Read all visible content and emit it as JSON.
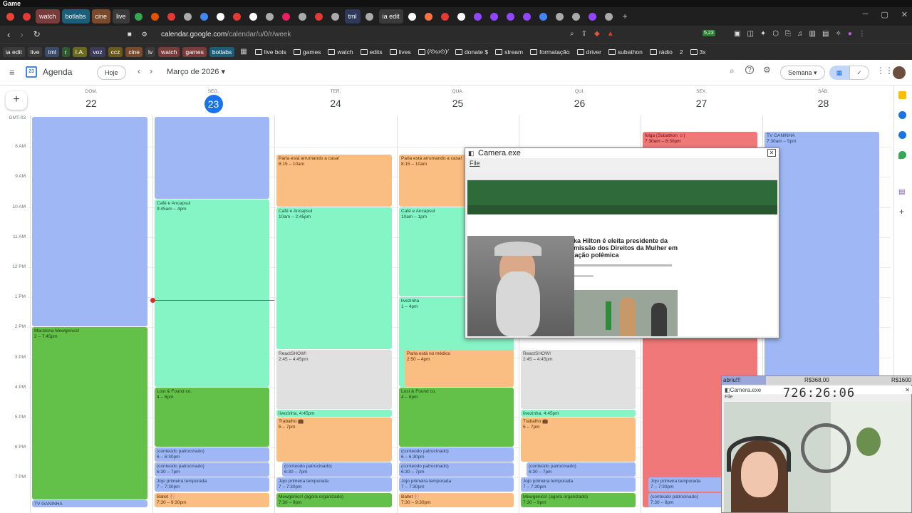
{
  "window": {
    "title": "Game"
  },
  "tabs": [
    {
      "label": "",
      "icon": "chrome-icon",
      "color": "#ea4335"
    },
    {
      "label": "",
      "icon": "record-icon",
      "color": "#e53935"
    },
    {
      "label": "watch",
      "color": "#7a3b3b"
    },
    {
      "label": "botlabs",
      "color": "#1b5e7a"
    },
    {
      "label": "cine",
      "color": "#7a4a2a"
    },
    {
      "label": "live",
      "color": "#3a3a3a"
    },
    {
      "label": "",
      "icon": "google-icon",
      "color": "#34a853"
    },
    {
      "label": "",
      "icon": "app-icon",
      "color": "#e65100"
    },
    {
      "label": "",
      "icon": "app-icon",
      "color": "#e53935"
    },
    {
      "label": "",
      "icon": "app-icon",
      "color": "#aaaaaa"
    },
    {
      "label": "",
      "icon": "app-icon",
      "color": "#4285f4"
    },
    {
      "label": "",
      "icon": "app-icon",
      "color": "#ffffff"
    },
    {
      "label": "",
      "icon": "app-icon",
      "color": "#e53935"
    },
    {
      "label": "",
      "icon": "app-icon",
      "color": "#ffffff"
    },
    {
      "label": "",
      "icon": "app-icon",
      "color": "#aaaaaa"
    },
    {
      "label": "",
      "icon": "app-icon",
      "color": "#e91e63"
    },
    {
      "label": "",
      "icon": "app-icon",
      "color": "#aaaaaa"
    },
    {
      "label": "",
      "icon": "app-icon",
      "color": "#e53935"
    },
    {
      "label": "",
      "icon": "app-icon",
      "color": "#aaaaaa"
    },
    {
      "label": "tml",
      "color": "#2f3a5a"
    },
    {
      "label": "",
      "icon": "app-icon",
      "color": "#aaaaaa"
    },
    {
      "label": "ia edit",
      "color": "#3a3a3a"
    },
    {
      "label": "",
      "icon": "tiktok-icon",
      "color": "#ffffff"
    },
    {
      "label": "",
      "icon": "app-icon",
      "color": "#ff7043"
    },
    {
      "label": "",
      "icon": "app-icon",
      "color": "#e53935"
    },
    {
      "label": "",
      "icon": "app-icon",
      "color": "#ffffff"
    },
    {
      "label": "",
      "icon": "twitch-icon",
      "color": "#9146ff"
    },
    {
      "label": "",
      "icon": "twitch-icon",
      "color": "#9146ff"
    },
    {
      "label": "",
      "icon": "twitch-icon",
      "color": "#9146ff"
    },
    {
      "label": "",
      "icon": "twitch-icon",
      "color": "#9146ff"
    },
    {
      "label": "",
      "icon": "app-icon",
      "color": "#4285f4"
    },
    {
      "label": "",
      "icon": "app-icon",
      "color": "#aaaaaa"
    },
    {
      "label": "",
      "icon": "app-icon",
      "color": "#aaaaaa"
    },
    {
      "label": "",
      "icon": "twitch-icon",
      "color": "#9146ff"
    },
    {
      "label": "",
      "icon": "app-icon",
      "color": "#aaaaaa"
    }
  ],
  "address_bar": {
    "host": "calendar.google.com",
    "path": "/calendar/u/0/r/week"
  },
  "extension_badge": "5,23",
  "bookmarks": {
    "chips": [
      {
        "label": "ia edit",
        "color": "#3a3a3a"
      },
      {
        "label": "live",
        "color": "#3a3a3a"
      },
      {
        "label": "tml",
        "color": "#3a4a6a"
      },
      {
        "label": "r",
        "color": "#2e5b2e"
      },
      {
        "label": "I.A.",
        "color": "#6a6a1a"
      },
      {
        "label": "voz",
        "color": "#3a3a5a"
      },
      {
        "label": "ccz",
        "color": "#6a5a1a"
      },
      {
        "label": "cine",
        "color": "#7a4a2a"
      },
      {
        "label": "lv",
        "color": "#3a3a3a"
      },
      {
        "label": "watch",
        "color": "#7a3b3b"
      },
      {
        "label": "games",
        "color": "#7a3b3b"
      },
      {
        "label": "botlabs",
        "color": "#1b5e7a"
      }
    ],
    "folders": [
      "live bots",
      "games",
      "watch",
      "edits",
      "lives",
      "(∕⊙ω⊙)∕",
      "donate $",
      "stream",
      "formatação",
      "driver",
      "subathon",
      "rádio",
      "3x"
    ],
    "badge": "2"
  },
  "calendar": {
    "app_name": "Agenda",
    "app_icon_day": "23",
    "today_button": "Hoje",
    "month_label": "Março de 2026",
    "view_button": "Semana",
    "timezone": "GMT-03",
    "days": [
      {
        "dow": "DOM.",
        "num": "22"
      },
      {
        "dow": "SEG.",
        "num": "23"
      },
      {
        "dow": "TER.",
        "num": "24"
      },
      {
        "dow": "QUA.",
        "num": "25"
      },
      {
        "dow": "QUI.",
        "num": "26"
      },
      {
        "dow": "SEX.",
        "num": "27"
      },
      {
        "dow": "SÁB.",
        "num": "28"
      }
    ],
    "hours": [
      "8 AM",
      "9 AM",
      "10 AM",
      "11 AM",
      "12 PM",
      "1 PM",
      "2 PM",
      "3 PM",
      "4 PM",
      "5 PM",
      "6 PM",
      "7 PM"
    ],
    "events": [
      {
        "day": 0,
        "start": 7.0,
        "end": 14.0,
        "title": "",
        "time": "",
        "c": "blue"
      },
      {
        "day": 0,
        "start": 14.0,
        "end": 19.75,
        "title": "Maratona Mewgenics!",
        "time": "2 – 7:45pm",
        "c": "dkgreen"
      },
      {
        "day": 0,
        "start": 19.75,
        "end": 20.0,
        "title": "TV GANINHA",
        "time": "",
        "c": "blue"
      },
      {
        "day": 1,
        "start": 7.0,
        "end": 9.75,
        "title": "",
        "time": "",
        "c": "blue"
      },
      {
        "day": 1,
        "start": 9.75,
        "end": 16.0,
        "title": "Café e Ancapsul",
        "time": "9:45am – 4pm",
        "c": "green"
      },
      {
        "day": 1,
        "start": 16.0,
        "end": 18.0,
        "title": "Lost & Found co.",
        "time": "4 – 6pm",
        "c": "dkgreen"
      },
      {
        "day": 1,
        "start": 18.0,
        "end": 18.5,
        "title": "(conteúdo patrocinado)",
        "time": "6 – 6:30pm",
        "c": "blue"
      },
      {
        "day": 1,
        "start": 18.5,
        "end": 19.0,
        "title": "(conteúdo patrocinado)",
        "time": "6:30 – 7pm",
        "c": "blue"
      },
      {
        "day": 1,
        "start": 19.0,
        "end": 19.5,
        "title": "Jojo primeira temporada",
        "time": "7 – 7:30pm",
        "c": "blue"
      },
      {
        "day": 1,
        "start": 19.5,
        "end": 20.0,
        "title": "Ballet 🩰",
        "time": "7:30 – 9:30pm",
        "c": "orange"
      },
      {
        "day": 2,
        "start": 8.25,
        "end": 10.0,
        "title": "Parla está arrumando a casa!",
        "time": "8:15 – 10am",
        "c": "orange"
      },
      {
        "day": 2,
        "start": 10.0,
        "end": 14.75,
        "title": "Café e Ancapsul",
        "time": "10am – 2:45pm",
        "c": "green"
      },
      {
        "day": 2,
        "start": 14.75,
        "end": 16.75,
        "title": "ReactSHOW!",
        "time": "2:45 – 4:45pm",
        "c": "grey"
      },
      {
        "day": 2,
        "start": 16.75,
        "end": 17.0,
        "title": "livezinha, 4:45pm",
        "time": "",
        "c": "green"
      },
      {
        "day": 2,
        "start": 17.0,
        "end": 18.5,
        "title": "Trabalho 💼",
        "time": "5 – 7pm",
        "c": "orange"
      },
      {
        "day": 2,
        "start": 18.5,
        "end": 19.0,
        "title": "(conteúdo patrocinado)",
        "time": "6:30 – 7pm",
        "c": "blue",
        "inset": 1
      },
      {
        "day": 2,
        "start": 19.0,
        "end": 19.5,
        "title": "Jojo primeira temporada",
        "time": "7 – 7:30pm",
        "c": "blue"
      },
      {
        "day": 2,
        "start": 19.5,
        "end": 20.0,
        "title": "Mewgenics! (agora organizado)",
        "time": "7:30 – 9pm",
        "c": "dkgreen"
      },
      {
        "day": 3,
        "start": 8.25,
        "end": 10.0,
        "title": "Parla está arrumando a casa!",
        "time": "8:15 – 10am",
        "c": "orange"
      },
      {
        "day": 3,
        "start": 10.0,
        "end": 13.0,
        "title": "Café e Ancapsul",
        "time": "10am – 1pm",
        "c": "green"
      },
      {
        "day": 3,
        "start": 13.0,
        "end": 16.0,
        "title": "livezinha",
        "time": "1 – 4pm",
        "c": "green"
      },
      {
        "day": 3,
        "start": 14.75,
        "end": 16.0,
        "title": "Parla está no médico",
        "time": "2:50 – 4pm",
        "c": "orange",
        "inset": 1
      },
      {
        "day": 3,
        "start": 16.0,
        "end": 18.0,
        "title": "Lost & Found co.",
        "time": "4 – 6pm",
        "c": "dkgreen"
      },
      {
        "day": 3,
        "start": 18.0,
        "end": 18.5,
        "title": "(conteúdo patrocinado)",
        "time": "6 – 6:30pm",
        "c": "blue"
      },
      {
        "day": 3,
        "start": 18.5,
        "end": 19.0,
        "title": "(conteúdo patrocinado)",
        "time": "6:30 – 7pm",
        "c": "blue"
      },
      {
        "day": 3,
        "start": 19.0,
        "end": 19.5,
        "title": "Jojo primeira temporada",
        "time": "7 – 7:30pm",
        "c": "blue"
      },
      {
        "day": 3,
        "start": 19.5,
        "end": 20.0,
        "title": "Ballet 🩰",
        "time": "7:30 – 9:30pm",
        "c": "orange"
      },
      {
        "day": 4,
        "start": 14.75,
        "end": 16.75,
        "title": "ReactSHOW!",
        "time": "2:45 – 4:45pm",
        "c": "grey"
      },
      {
        "day": 4,
        "start": 16.75,
        "end": 17.0,
        "title": "livezinha, 4:45pm",
        "time": "",
        "c": "green"
      },
      {
        "day": 4,
        "start": 17.0,
        "end": 18.5,
        "title": "Trabalho 💼",
        "time": "5 – 7pm",
        "c": "orange"
      },
      {
        "day": 4,
        "start": 18.5,
        "end": 19.0,
        "title": "(conteúdo patrocinado)",
        "time": "6:30 – 7pm",
        "c": "blue",
        "inset": 1
      },
      {
        "day": 4,
        "start": 19.0,
        "end": 19.5,
        "title": "Jojo primeira temporada",
        "time": "7 – 7:30pm",
        "c": "blue"
      },
      {
        "day": 4,
        "start": 19.5,
        "end": 20.0,
        "title": "Mewgenics! (agora organizado)",
        "time": "7:30 – 9pm",
        "c": "dkgreen"
      },
      {
        "day": 5,
        "start": 7.5,
        "end": 20.0,
        "title": "folga (Subathon ☺)",
        "time": "7:30am – 8:30pm",
        "c": "red"
      },
      {
        "day": 5,
        "start": 19.0,
        "end": 19.5,
        "title": "Jojo primeira temporada",
        "time": "7 – 7:30pm",
        "c": "blue",
        "inset": 1
      },
      {
        "day": 5,
        "start": 19.5,
        "end": 20.0,
        "title": "(conteúdo patrocinado)",
        "time": "7:30 – 8pm",
        "c": "blue",
        "inset": 1
      },
      {
        "day": 6,
        "start": 7.5,
        "end": 20.0,
        "title": "TV GANINHA",
        "time": "7:30am – 5pm",
        "c": "blue"
      }
    ]
  },
  "camera_window": {
    "title": "Camera.exe",
    "menu_file": "File",
    "article_headline": "Erika Hilton é eleita presidente da Comissão dos Direitos da Mulher em votação polêmica"
  },
  "stream_overlay": {
    "goal_label": "abriu!!!",
    "amount_current": "R$368,00",
    "amount_goal": "R$1600",
    "window_title": "Camera.exe",
    "menu_file": "File",
    "timer": "726:26:06"
  },
  "colors": {
    "blue": "#9fb8f5",
    "green": "#86f5c6",
    "dkgreen": "#63c14a",
    "orange": "#fbbe82",
    "grey": "#e0e0e0",
    "red": "#f07878",
    "today": "#1a73e8",
    "now_line": "#d93025"
  }
}
